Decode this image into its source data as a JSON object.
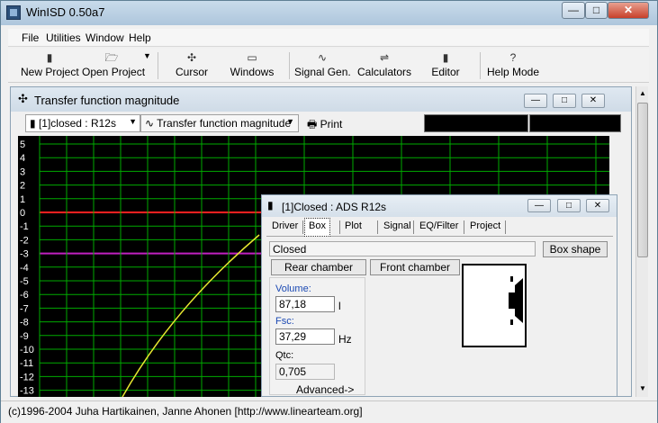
{
  "app": {
    "title": "WinISD 0.50a7"
  },
  "window_controls": {
    "minimize": "—",
    "maximize": "□",
    "close": "✕"
  },
  "menu": {
    "file": "File",
    "utilities": "Utilities",
    "window": "Window",
    "help": "Help"
  },
  "toolbar": {
    "new_project": "New Project",
    "open_project": "Open Project",
    "cursor": "Cursor",
    "windows": "Windows",
    "signal_gen": "Signal Gen.",
    "calculators": "Calculators",
    "editor": "Editor",
    "help_mode": "Help Mode",
    "icons": {
      "new_project": "▮",
      "open_project": "🗁",
      "cursor": "✣",
      "windows": "▭",
      "signal_gen": "∿",
      "calculators": "⇌",
      "editor": "▮",
      "help_mode": "?"
    }
  },
  "child_window": {
    "title": "Transfer function magnitude",
    "series_select": "[1]closed : R12s",
    "view_select": "Transfer function magnitude",
    "print_label": "Print"
  },
  "plot": {
    "y_ticks": [
      "5",
      "4",
      "3",
      "2",
      "1",
      "0",
      "-1",
      "-2",
      "-3",
      "-4",
      "-5",
      "-6",
      "-7",
      "-8",
      "-9",
      "-10",
      "-11",
      "-12",
      "-13"
    ],
    "grid_color": "#00aa00",
    "zero_line_color": "#ff2020",
    "minus3_line_color": "#c020c0",
    "curve_color": "#e8e830"
  },
  "box_window": {
    "title": "[1]Closed : ADS R12s",
    "tabs": [
      "Driver",
      "Box",
      "Plot",
      "Signal",
      "EQ/Filter",
      "Project"
    ],
    "active_tab": "Box",
    "box_type": "Closed",
    "box_shape_label": "Box shape",
    "rear_chamber_label": "Rear chamber",
    "front_chamber_label": "Front chamber",
    "volume_label": "Volume:",
    "volume_value": "87,18",
    "volume_unit": "l",
    "fsc_label": "Fsc:",
    "fsc_value": "37,29",
    "fsc_unit": "Hz",
    "qtc_label": "Qtc:",
    "qtc_value": "0,705",
    "advanced_label": "Advanced->"
  },
  "status": {
    "text": "(c)1996-2004 Juha Hartikainen, Janne Ahonen [http://www.linearteam.org]"
  }
}
